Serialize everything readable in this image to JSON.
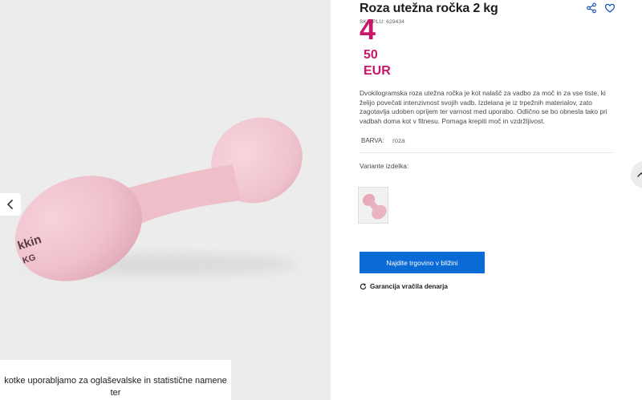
{
  "product": {
    "title": "Roza utežna ročka 2 kg",
    "sku": "SKU/PLU: 629434",
    "price_int": "4",
    "price_dec": "50",
    "currency": "EUR",
    "accent_color": "#c8166a",
    "description": "Dvokilogramska roza utežna ročka je kot nalašč za vadbo za moč in za vse tiste, ki želijo povečati intenzivnost svojih vadb. Izdelana je iz trpežnih materialov, zato zagotavlja udoben oprijem ter varnost med uporabo. Odlično se bo obnesla tako pri vadbah doma kot v fitnesu. Pomaga krepiti moč in vzdržljivost.",
    "attribute": {
      "label": "BARVA:",
      "value": "roza"
    },
    "variants_label": "Variante izdelka:"
  },
  "image": {
    "brand_text": "Kalenji"
  },
  "actions": {
    "share_icon": "share-icon",
    "wishlist_icon": "heart-icon",
    "cta_label": "Najdite trgovino v bližini",
    "cta_color": "#0b6bd6",
    "guarantee_label": "Garancija vračila denarja"
  },
  "cookie": {
    "text": "kotke uporabljamo za oglaševalske in statistične namene ter\nprilagoditev ponudbe vašim potrebam."
  }
}
